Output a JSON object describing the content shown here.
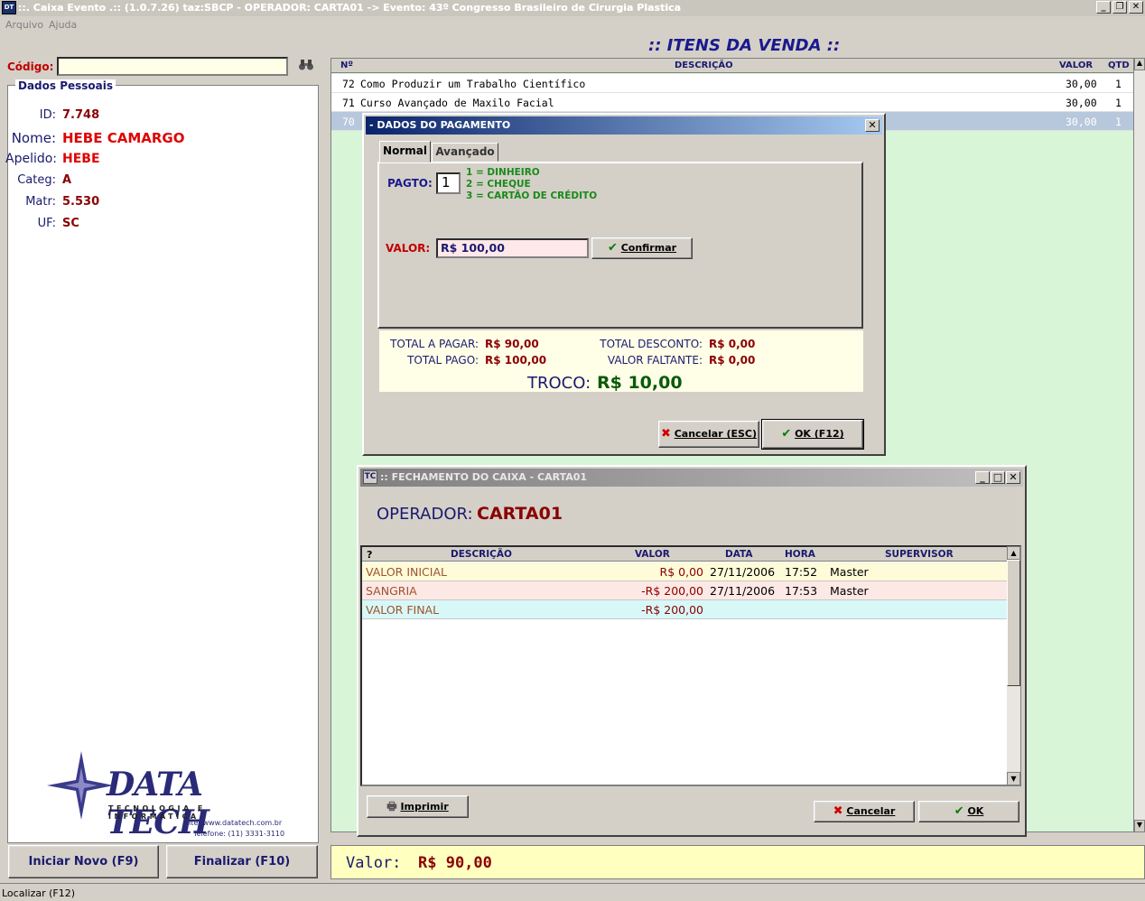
{
  "app": {
    "title": "::. Caixa Evento .:: (1.0.7.26) taz:SBCP - OPERADOR: CARTA01 -> Evento: 43º Congresso Brasileiro de Cirurgia Plastica",
    "icon_text": "DT",
    "menu": [
      "Arquivo",
      "Ajuda"
    ],
    "status": "Localizar (F12)"
  },
  "left": {
    "codigo_label": "Código:",
    "codigo_value": "",
    "group_title": "Dados Pessoais",
    "fields": [
      {
        "label": "ID:",
        "value": "7.748"
      },
      {
        "label": "Nome:",
        "value": "HEBE CAMARGO"
      },
      {
        "label": "Apelido:",
        "value": "HEBE"
      },
      {
        "label": "Categ:",
        "value": "A"
      },
      {
        "label": "Matr:",
        "value": "5.530"
      },
      {
        "label": "UF:",
        "value": "SC"
      }
    ],
    "logo": {
      "name": "DATA TECH",
      "tagline": "TECNOLOGIA E INFORMÁTICA",
      "site": "Site: www.datatech.com.br",
      "phone": "Telefone: (11) 3331-3110"
    },
    "btn_novo": "Iniciar Novo (F9)",
    "btn_finalizar": "Finalizar (F10)"
  },
  "itens": {
    "title": ":: ITENS DA VENDA ::",
    "headers": {
      "num": "Nº",
      "desc": "DESCRIÇÃO",
      "valor": "VALOR",
      "qtd": "QTD"
    },
    "rows": [
      {
        "num": "72",
        "desc": "Como Produzir um Trabalho Científico",
        "valor": "30,00",
        "qtd": "1"
      },
      {
        "num": "71",
        "desc": "Curso Avançado de Maxilo Facial",
        "valor": "30,00",
        "qtd": "1"
      },
      {
        "num": "70",
        "desc": "",
        "valor": "30,00",
        "qtd": "1"
      }
    ],
    "valor_label": "Valor:",
    "valor_total": "R$ 90,00"
  },
  "payment": {
    "title": "- DADOS DO PAGAMENTO",
    "tab_normal": "Normal",
    "tab_avancado": "Avançado",
    "pagto_label": "PAGTO:",
    "pagto_value": "1",
    "options": [
      "1 = DINHEIRO",
      "2 = CHEQUE",
      "3 = CARTÃO DE CRÉDITO"
    ],
    "valor_label": "VALOR:",
    "valor_value": "R$ 100,00",
    "confirmar": "Confirmar",
    "total_a_pagar_label": "TOTAL A PAGAR:",
    "total_a_pagar": "R$ 90,00",
    "total_pago_label": "TOTAL PAGO:",
    "total_pago": "R$ 100,00",
    "total_desconto_label": "TOTAL DESCONTO:",
    "total_desconto": "R$ 0,00",
    "valor_faltante_label": "VALOR FALTANTE:",
    "valor_faltante": "R$ 0,00",
    "troco_label": "TROCO:",
    "troco_value": "R$ 10,00",
    "cancelar": "Cancelar (ESC)",
    "ok": "OK (F12)"
  },
  "fechamento": {
    "title": ":: FECHAMENTO DO CAIXA - CARTA01",
    "operador_label": "OPERADOR:",
    "operador_value": "CARTA01",
    "headers": {
      "q": "?",
      "desc": "DESCRIÇÃO",
      "valor": "VALOR",
      "data": "DATA",
      "hora": "HORA",
      "supervisor": "SUPERVISOR"
    },
    "rows": [
      {
        "desc": "VALOR INICIAL",
        "valor": "R$  0,00",
        "data": "27/11/2006",
        "hora": "17:52",
        "supervisor": "Master",
        "bg": "#fdfbd8"
      },
      {
        "desc": "SANGRIA",
        "valor": "-R$  200,00",
        "data": "27/11/2006",
        "hora": "17:53",
        "supervisor": "Master",
        "bg": "#fce8e4"
      },
      {
        "desc": "VALOR FINAL",
        "valor": "-R$  200,00",
        "data": "",
        "hora": "",
        "supervisor": "",
        "bg": "#d8f8f8"
      }
    ],
    "imprimir": "Imprimir",
    "cancelar": "Cancelar",
    "ok": "OK"
  },
  "colors": {
    "accent_red": "#c00000",
    "navy": "#1a1a6e",
    "dark_red": "#8b0000",
    "grid_green": "#d8f5d8"
  }
}
